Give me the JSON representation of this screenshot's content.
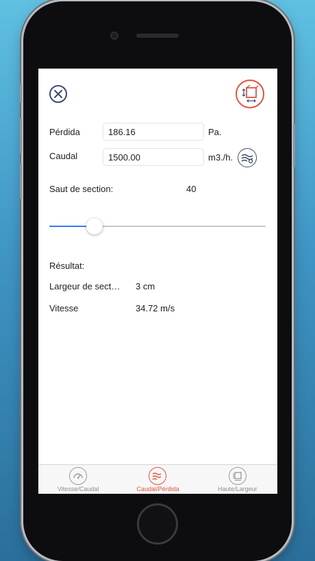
{
  "colors": {
    "accent": "#e0533f",
    "slider_fill": "#3478f6",
    "icon_dark": "#3d4a6e"
  },
  "header": {
    "close_icon": "close-icon",
    "mode_icon": "section-square-icon"
  },
  "form": {
    "perdida": {
      "label": "Pérdida",
      "value": "186.16",
      "unit": "Pa."
    },
    "caudal": {
      "label": "Caudal",
      "value": "1500.00",
      "unit": "m3./h.",
      "icon": "airflow-convert-icon"
    }
  },
  "slider": {
    "label": "Saut de section:",
    "value": "40",
    "fraction": 0.21
  },
  "result": {
    "title": "Résultat:",
    "rows": [
      {
        "label": "Largeur de sect…",
        "value": "3 cm"
      },
      {
        "label": "Vitesse",
        "value": "34.72 m/s"
      }
    ]
  },
  "tabbar": {
    "tabs": [
      {
        "label": "Vitesse/Caudal",
        "icon": "gauge-icon",
        "active": false
      },
      {
        "label": "Caudal/Pérdida",
        "icon": "airflow-icon",
        "active": true
      },
      {
        "label": "Haute/Largeur",
        "icon": "section-icon",
        "active": false
      }
    ]
  }
}
